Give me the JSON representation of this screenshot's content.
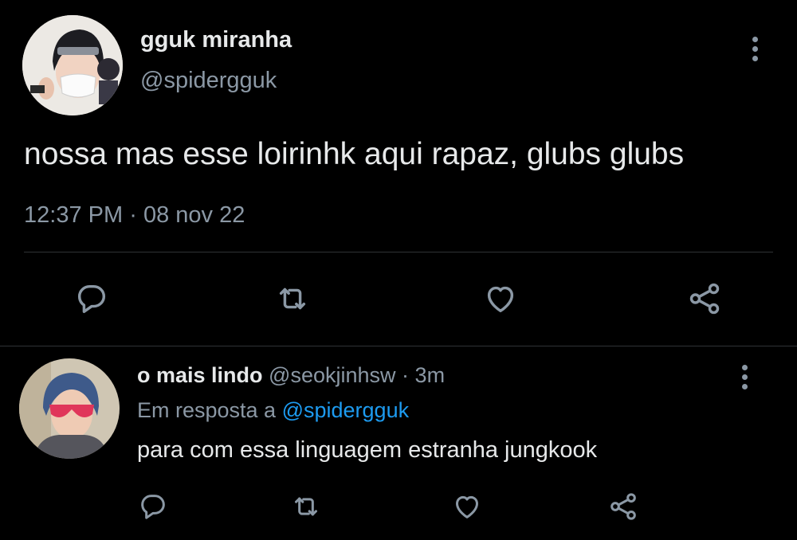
{
  "main_tweet": {
    "display_name": "gguk miranha",
    "handle": "@spidergguk",
    "text": "nossa mas esse loirinhk aqui rapaz, glubs glubs",
    "time": "12:37 PM",
    "separator": "·",
    "date": "08 nov 22"
  },
  "reply": {
    "display_name": "o mais lindo",
    "handle": "@seokjinhsw",
    "separator": "·",
    "age": "3m",
    "replying_prefix": "Em resposta a",
    "replying_to": "@spidergguk",
    "text": "para com essa linguagem estranha jungkook"
  },
  "colors": {
    "background": "#000000",
    "text": "#e7e9ea",
    "muted": "#8b98a5",
    "link": "#1d9bf0",
    "divider": "#2f3336"
  },
  "icons": [
    "reply-icon",
    "retweet-icon",
    "like-icon",
    "share-icon",
    "more-icon"
  ]
}
